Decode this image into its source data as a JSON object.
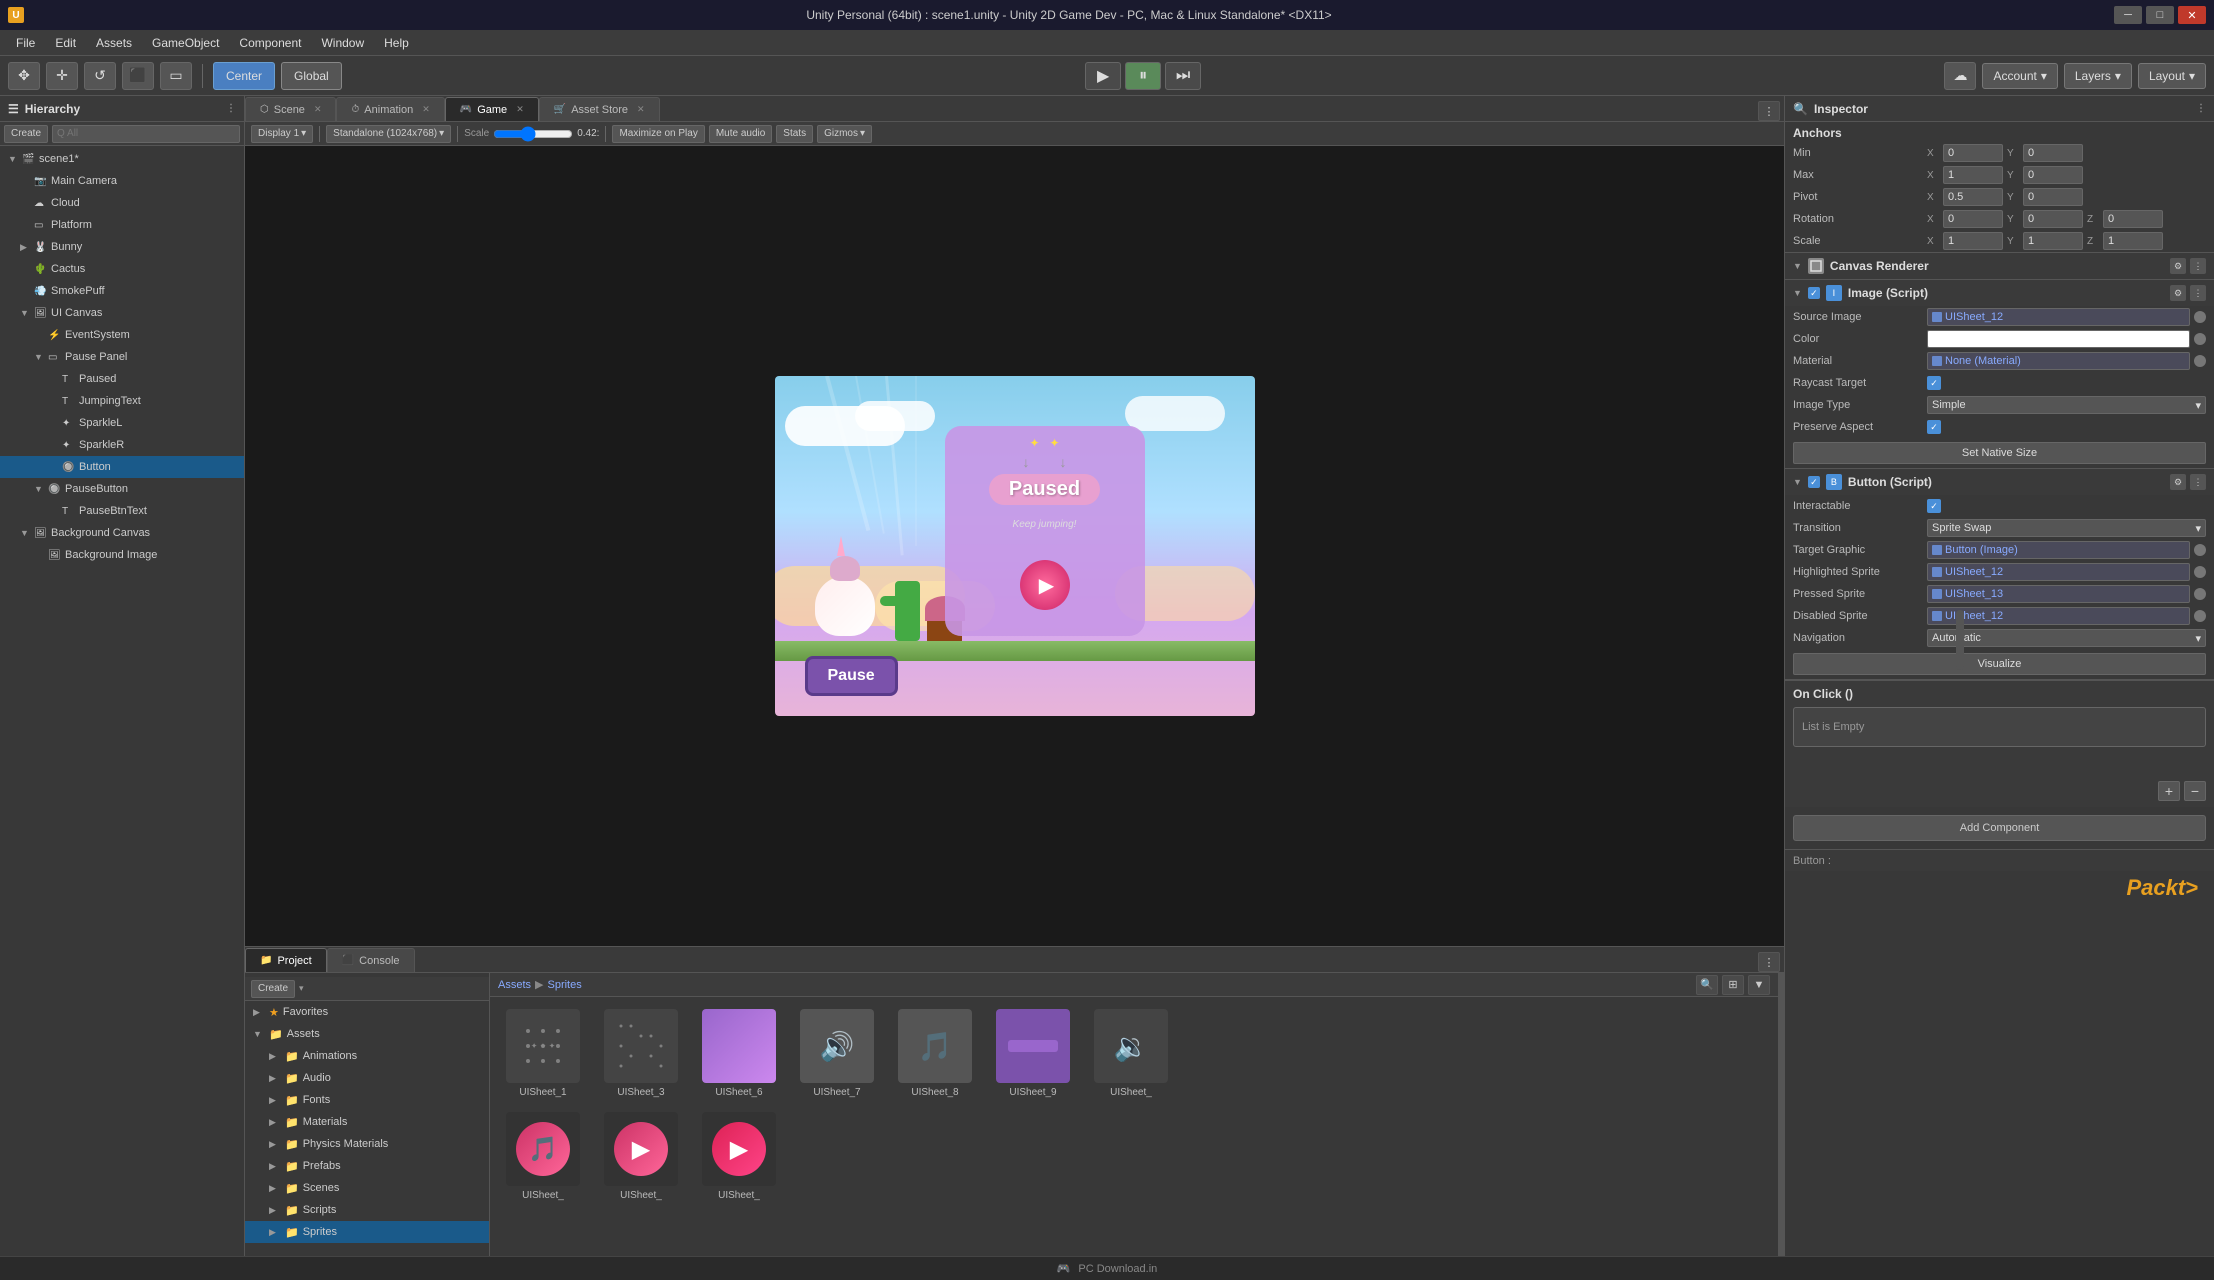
{
  "titleBar": {
    "icon": "U",
    "title": "Unity Personal (64bit) : scene1.unity - Unity 2D Game Dev - PC, Mac & Linux Standalone* <DX11>",
    "minimize": "─",
    "maximize": "□",
    "close": "✕"
  },
  "menuBar": {
    "items": [
      "File",
      "Edit",
      "Assets",
      "GameObject",
      "Component",
      "Window",
      "Help"
    ]
  },
  "toolbar": {
    "tools": [
      "✥",
      "+",
      "↺",
      "⬛",
      "▭"
    ],
    "centerBtn": "Center",
    "globalBtn": "Global",
    "play": "▶",
    "pause": "⏸",
    "step": "⏭",
    "accountLabel": "Account",
    "layersLabel": "Layers",
    "layoutLabel": "Layout"
  },
  "hierarchy": {
    "title": "Hierarchy",
    "createBtn": "Create",
    "allBtn": "All",
    "items": [
      {
        "id": "scene1",
        "label": "scene1*",
        "depth": 0,
        "hasArrow": true,
        "expanded": true
      },
      {
        "id": "mainCamera",
        "label": "Main Camera",
        "depth": 1,
        "hasArrow": false
      },
      {
        "id": "cloud",
        "label": "Cloud",
        "depth": 1,
        "hasArrow": false
      },
      {
        "id": "platform",
        "label": "Platform",
        "depth": 1,
        "hasArrow": false
      },
      {
        "id": "bunny",
        "label": "Bunny",
        "depth": 1,
        "hasArrow": true,
        "expanded": false
      },
      {
        "id": "cactus",
        "label": "Cactus",
        "depth": 1,
        "hasArrow": false
      },
      {
        "id": "smokePuff",
        "label": "SmokePuff",
        "depth": 1,
        "hasArrow": false
      },
      {
        "id": "uiCanvas",
        "label": "UI Canvas",
        "depth": 1,
        "hasArrow": true,
        "expanded": true
      },
      {
        "id": "eventSystem",
        "label": "EventSystem",
        "depth": 2,
        "hasArrow": false
      },
      {
        "id": "pausePanel",
        "label": "Pause Panel",
        "depth": 2,
        "hasArrow": true,
        "expanded": true
      },
      {
        "id": "paused",
        "label": "Paused",
        "depth": 3,
        "hasArrow": false
      },
      {
        "id": "jumpingText",
        "label": "JumpingText",
        "depth": 3,
        "hasArrow": false
      },
      {
        "id": "sparkleL",
        "label": "SparkleL",
        "depth": 3,
        "hasArrow": false
      },
      {
        "id": "sparkleR",
        "label": "SparkleR",
        "depth": 3,
        "hasArrow": false
      },
      {
        "id": "button",
        "label": "Button",
        "depth": 3,
        "hasArrow": false,
        "selected": true
      },
      {
        "id": "pauseButton",
        "label": "PauseButton",
        "depth": 2,
        "hasArrow": true,
        "expanded": false
      },
      {
        "id": "pauseBtnText",
        "label": "PauseBtnText",
        "depth": 3,
        "hasArrow": false
      },
      {
        "id": "bgCanvas",
        "label": "Background Canvas",
        "depth": 1,
        "hasArrow": true,
        "expanded": true
      },
      {
        "id": "bgImage",
        "label": "Background Image",
        "depth": 2,
        "hasArrow": false
      }
    ]
  },
  "tabs": {
    "scene": "Scene",
    "animation": "Animation",
    "game": "Game",
    "assetStore": "Asset Store"
  },
  "gameToolbar": {
    "display": "Display 1",
    "resolution": "Standalone (1024x768)",
    "scale": "Scale",
    "scaleValue": "0.42:",
    "maximizeOnPlay": "Maximize on Play",
    "muteAudio": "Mute audio",
    "stats": "Stats",
    "gizmos": "Gizmos"
  },
  "inspector": {
    "title": "Inspector",
    "anchors": {
      "min": {
        "x": "0",
        "y": "0"
      },
      "max": {
        "x": "1",
        "y": "0"
      },
      "pivot": {
        "x": "0.5",
        "y": "0"
      },
      "rotation": {
        "x": "0",
        "y": "0",
        "z": "0"
      },
      "scale": {
        "x": "1",
        "y": "1",
        "z": "1"
      }
    },
    "canvasRenderer": {
      "title": "Canvas Renderer"
    },
    "imageScript": {
      "title": "Image (Script)",
      "sourceImage": "UISheet_12",
      "color": "",
      "material": "None (Material)",
      "raycastTarget": true,
      "imageType": "Simple",
      "preserveAspect": true,
      "setNativeSizeBtn": "Set Native Size"
    },
    "buttonScript": {
      "title": "Button (Script)",
      "interactable": true,
      "transition": "Sprite Swap",
      "targetGraphic": "Button (Image)",
      "highlightedSprite": "UISheet_12",
      "pressedSprite": "UISheet_13",
      "disabledSprite": "UISheet_12",
      "navigation": "Automatic",
      "visualizeBtn": "Visualize"
    },
    "onClick": {
      "title": "On Click ()",
      "listEmpty": "List is Empty"
    },
    "addComponentBtn": "Add Component",
    "bottomLabel": "Button :"
  },
  "project": {
    "title": "Project",
    "consoleTitle": "Console",
    "createBtn": "Create",
    "favorites": "Favorites",
    "assets": "Assets",
    "folders": [
      "Animations",
      "Audio",
      "Fonts",
      "Materials",
      "Physics Materials",
      "Prefabs",
      "Scenes",
      "Scripts",
      "Sprites"
    ],
    "breadcrumb": [
      "Assets",
      "Sprites"
    ]
  },
  "assetItems": {
    "row1": [
      {
        "name": "UISheet_1",
        "type": "dotted"
      },
      {
        "name": "UISheet_3",
        "type": "dotted2"
      },
      {
        "name": "UISheet_6",
        "type": "purple-fade"
      },
      {
        "name": "UISheet_7",
        "type": "speaker"
      },
      {
        "name": "UISheet_8",
        "type": "music"
      },
      {
        "name": "UISheet_9",
        "type": "purple-bar"
      },
      {
        "name": "UISheet_",
        "type": "speaker-dark"
      }
    ],
    "row2": [
      {
        "name": "UISheet_",
        "type": "music-pink"
      },
      {
        "name": "UISheet_",
        "type": "play-pink"
      },
      {
        "name": "UISheet_",
        "type": "play-pink2"
      }
    ]
  },
  "statusBar": {
    "icon": "🎮",
    "text": "PC Download.in"
  }
}
